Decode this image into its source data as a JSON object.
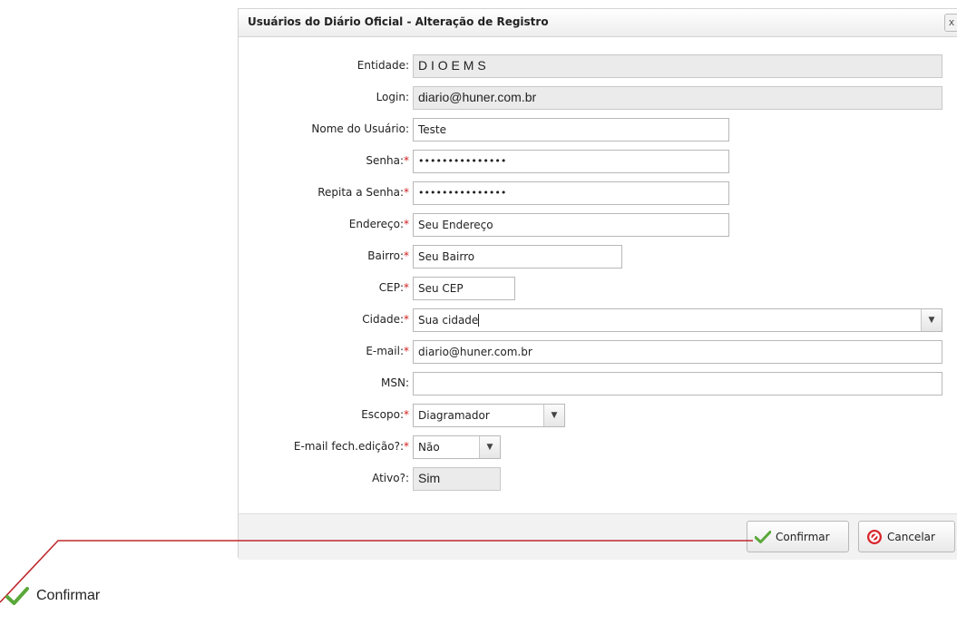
{
  "dialog": {
    "title": "Usuários do Diário Oficial - Alteração de Registro",
    "close_symbol": "x"
  },
  "form": {
    "entidade": {
      "label": "Entidade:",
      "value": "D I O E M S"
    },
    "login": {
      "label": "Login:",
      "value": "diario@huner.com.br"
    },
    "nome": {
      "label": "Nome do Usuário:",
      "value": "Teste"
    },
    "senha": {
      "label": "Senha:",
      "required_mark": "*",
      "value": "•••••••••••••••"
    },
    "repita_senha": {
      "label": "Repita a Senha:",
      "required_mark": "*",
      "value": "•••••••••••••••"
    },
    "endereco": {
      "label": "Endereço:",
      "required_mark": "*",
      "value": "Seu Endereço"
    },
    "bairro": {
      "label": "Bairro:",
      "required_mark": "*",
      "value": "Seu Bairro"
    },
    "cep": {
      "label": "CEP:",
      "required_mark": "*",
      "value": "Seu CEP"
    },
    "cidade": {
      "label": "Cidade:",
      "required_mark": "*",
      "value": "Sua cidade"
    },
    "email": {
      "label": "E-mail:",
      "required_mark": "*",
      "value": "diario@huner.com.br"
    },
    "msn": {
      "label": "MSN:",
      "value": ""
    },
    "escopo": {
      "label": "Escopo:",
      "required_mark": "*",
      "value": "Diagramador"
    },
    "email_fech": {
      "label": "E-mail fech.edição?:",
      "required_mark": "*",
      "value": "Não"
    },
    "ativo": {
      "label": "Ativo?:",
      "value": "Sim"
    }
  },
  "buttons": {
    "confirm_label": "Confirmar",
    "cancel_label": "Cancelar"
  },
  "zoom_callout": {
    "label": "Confirmar"
  },
  "colors": {
    "required": "#d02020",
    "annotation_line": "#c0282d",
    "confirm_icon": "#5aa83a",
    "cancel_icon": "#d8262b"
  },
  "icons": {
    "confirm": "checkmark-icon",
    "cancel": "no-entry-icon",
    "select": "chevron-down-icon"
  }
}
